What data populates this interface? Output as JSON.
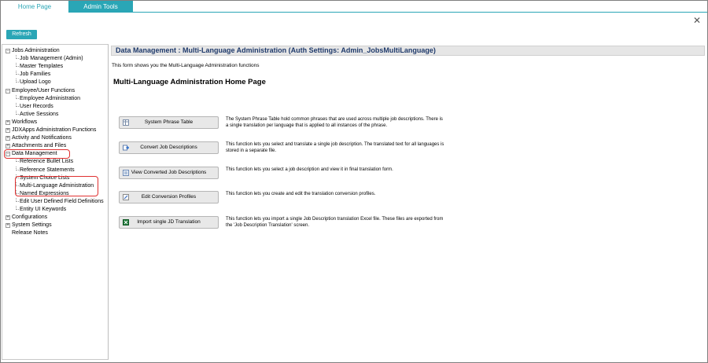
{
  "tabs": [
    {
      "label": "Home Page"
    },
    {
      "label": "Admin Tools"
    }
  ],
  "toolbar": {
    "refresh_label": "Refresh",
    "close_glyph": "✕"
  },
  "tree": [
    {
      "label": "Jobs Administration",
      "level": 0,
      "expanded": true
    },
    {
      "label": "Job Management (Admin)",
      "level": 1
    },
    {
      "label": "Master Templates",
      "level": 1
    },
    {
      "label": "Job Families",
      "level": 1
    },
    {
      "label": "Upload Logo",
      "level": 1
    },
    {
      "label": "Employee/User Functions",
      "level": 0,
      "expanded": true
    },
    {
      "label": "Employee Administration",
      "level": 1
    },
    {
      "label": "User Records",
      "level": 1
    },
    {
      "label": "Active Sessions",
      "level": 1
    },
    {
      "label": "Workflows",
      "level": 0,
      "expanded": false
    },
    {
      "label": "JDXApps Administration Functions",
      "level": 0,
      "expanded": false
    },
    {
      "label": "Activity and Notifications",
      "level": 0,
      "expanded": false
    },
    {
      "label": "Attachments and Files",
      "level": 0,
      "expanded": false
    },
    {
      "label": "Data Management",
      "level": 0,
      "expanded": true
    },
    {
      "label": "Reference Bullet Lists",
      "level": 1
    },
    {
      "label": "Reference Statements",
      "level": 1
    },
    {
      "label": "System Choice Lists",
      "level": 1
    },
    {
      "label": "Multi-Language Administration",
      "level": 1
    },
    {
      "label": "Named Expressions",
      "level": 1
    },
    {
      "label": "Edit User Defined Field Definitions",
      "level": 1
    },
    {
      "label": "Entity UI Keywords",
      "level": 1
    },
    {
      "label": "Configurations",
      "level": 0,
      "expanded": false
    },
    {
      "label": "System Settings",
      "level": 0,
      "expanded": false
    },
    {
      "label": "Release Notes",
      "level": 0,
      "leaf": true
    }
  ],
  "content": {
    "header": "Data Management : Multi-Language Administration (Auth Settings: Admin_JobsMultiLanguage)",
    "description": "This form shows you the Multi-Language Administration functions",
    "title": "Multi-Language Administration Home Page",
    "functions": [
      {
        "button": "System Phrase Table",
        "icon": "table-icon",
        "text": "The System Phrase Table hold common phrases that are used across multiple job descriptions. There is a single translation per language that is applied to all instances of the phrase."
      },
      {
        "button": "Convert Job Descriptions",
        "icon": "convert-icon",
        "text": "This function lets you select and translate a single job description. The translated text for all languages is stored in a separate file."
      },
      {
        "button": "View Converted Job Descriptions",
        "icon": "view-icon",
        "text": "This function lets you select a job description and view it in final translation form."
      },
      {
        "button": "Edit Conversion Profiles",
        "icon": "edit-icon",
        "text": "This function lets you create and edit the translation conversion profiles."
      },
      {
        "button": "Import single JD Translation",
        "icon": "excel-icon",
        "text": "This function lets you import a single Job Description translation Excel file. These files are exported from the 'Job Description Translation' screen."
      }
    ]
  },
  "colors": {
    "accent": "#2aa6b6",
    "header_text": "#1f3a6b",
    "highlight": "#e03030"
  }
}
